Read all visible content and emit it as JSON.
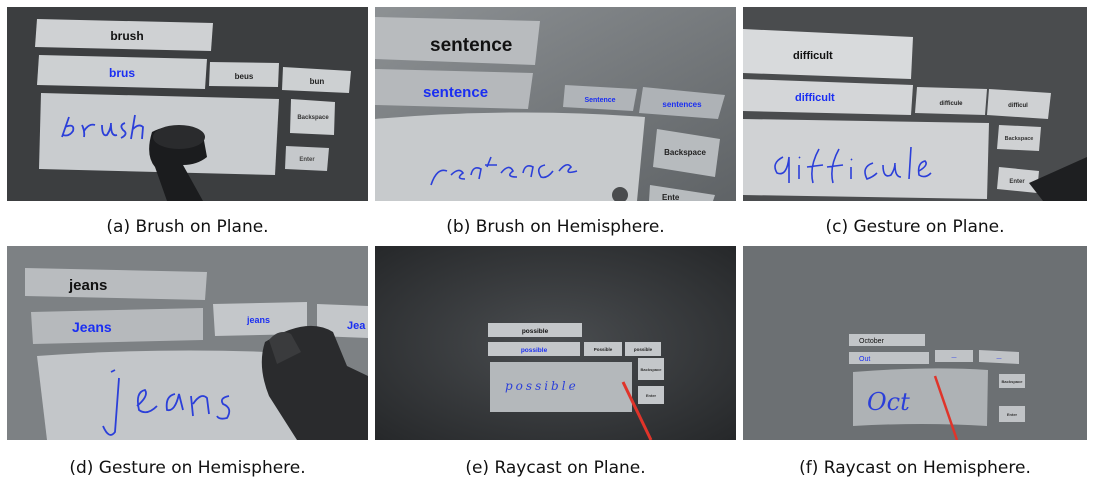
{
  "panels": [
    {
      "id": "a",
      "caption": "(a) Brush on Plane.",
      "target_word": "brush",
      "candidates": [
        "brus",
        "beus",
        "bun"
      ],
      "handwriting": "brush",
      "buttons": {
        "backspace": "Backspace",
        "enter": "Enter"
      }
    },
    {
      "id": "b",
      "caption": "(b) Brush on Hemisphere.",
      "target_word": "sentence",
      "candidates": [
        "sentence",
        "Sentence",
        "sentences"
      ],
      "handwriting": "sentence",
      "buttons": {
        "backspace": "Backspace",
        "enter": "Ente"
      }
    },
    {
      "id": "c",
      "caption": "(c) Gesture on Plane.",
      "target_word": "difficult",
      "candidates": [
        "difficult",
        "difficule",
        "difficul"
      ],
      "handwriting": "difficule",
      "buttons": {
        "backspace": "Backspace",
        "enter": "Enter"
      }
    },
    {
      "id": "d",
      "caption": "(d) Gesture on Hemisphere.",
      "target_word": "jeans",
      "candidates": [
        "Jeans",
        "jeans",
        "Jea"
      ],
      "handwriting": "jeans"
    },
    {
      "id": "e",
      "caption": "(e) Raycast on Plane.",
      "target_word": "possible",
      "candidates": [
        "possible",
        "Possible",
        "possible"
      ],
      "handwriting": "possible",
      "buttons": {
        "backspace": "Backspace",
        "enter": "Enter"
      }
    },
    {
      "id": "f",
      "caption": "(f) Raycast on Hemisphere.",
      "target_word": "October",
      "candidates": [
        "Out",
        "—",
        "—"
      ],
      "handwriting": "Oct",
      "buttons": {
        "backspace": "Backspace",
        "enter": "Enter"
      }
    }
  ],
  "colors": {
    "background_dark": "#3a3c3e",
    "panel_light": "#d6d8da",
    "ink_blue": "#2b3fd9",
    "candidate_blue": "#1a2ef2",
    "ray_red": "#e0342a"
  }
}
